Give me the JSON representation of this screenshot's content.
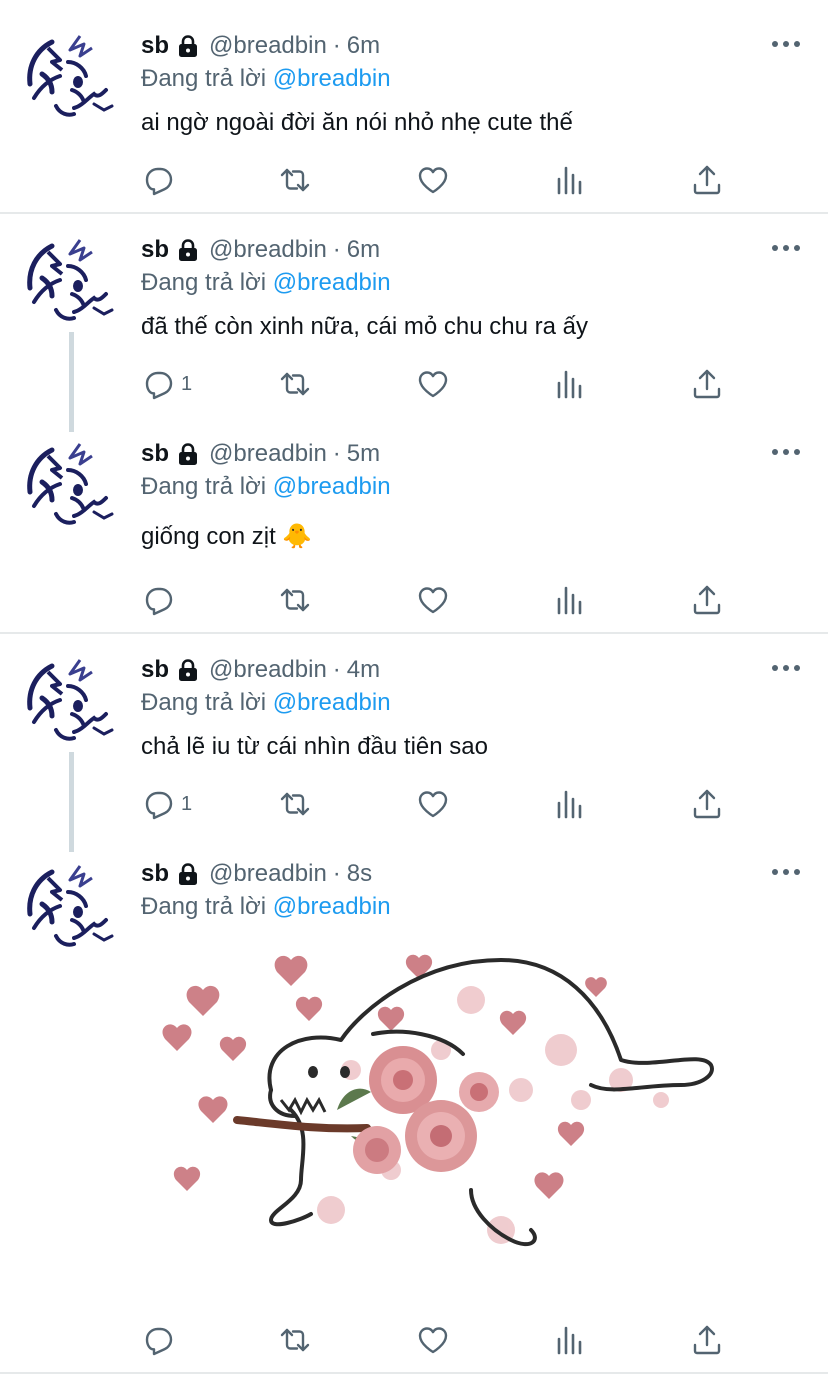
{
  "tweets": [
    {
      "name": "sb",
      "handle": "@breadbin",
      "time": "6m",
      "reply_prefix": "Đang trả lời",
      "reply_mention": "@breadbin",
      "text": "ai ngờ ngoài đời ăn nói nhỏ nhẹ cute thế",
      "reply_count": ""
    },
    {
      "name": "sb",
      "handle": "@breadbin",
      "time": "6m",
      "reply_prefix": "Đang trả lời",
      "reply_mention": "@breadbin",
      "text": "đã thế còn xinh nữa, cái mỏ chu chu ra ấy",
      "reply_count": "1"
    },
    {
      "name": "sb",
      "handle": "@breadbin",
      "time": "5m",
      "reply_prefix": "Đang trả lời",
      "reply_mention": "@breadbin",
      "text": "giống con zịt 🐥",
      "reply_count": ""
    },
    {
      "name": "sb",
      "handle": "@breadbin",
      "time": "4m",
      "reply_prefix": "Đang trả lời",
      "reply_mention": "@breadbin",
      "text": "chả lẽ iu từ cái nhìn đầu tiên sao",
      "reply_count": "1"
    },
    {
      "name": "sb",
      "handle": "@breadbin",
      "time": "8s",
      "reply_prefix": "Đang trả lời",
      "reply_mention": "@breadbin",
      "text": "",
      "reply_count": ""
    }
  ],
  "icons": {
    "reply": "reply-icon",
    "retweet": "retweet-icon",
    "like": "heart-icon",
    "analytics": "analytics-icon",
    "share": "share-icon",
    "lock": "lock-icon",
    "more": "more-icon"
  },
  "colors": {
    "text": "#0f1419",
    "secondary": "#536471",
    "accent": "#1d9bf0",
    "divider": "#e6e9ea",
    "thread_line": "#cfd9de"
  }
}
